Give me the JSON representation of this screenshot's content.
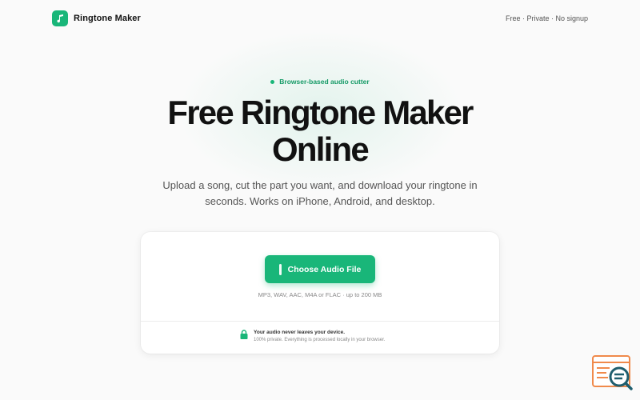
{
  "header": {
    "brand": "Ringtone Maker",
    "logo_icon": "music-note-icon",
    "tagline": "Free · Private · No signup"
  },
  "hero": {
    "pill": "Browser-based audio cutter",
    "title_line1": "Free Ringtone Maker",
    "title_line2": "Online",
    "subtitle_line1": "Upload a song, cut the part you want, and download your ringtone in",
    "subtitle_line2": "seconds. Works on iPhone, Android, and desktop."
  },
  "upload": {
    "button_label": "Choose Audio File",
    "formats": "MP3, WAV, AAC, M4A or FLAC · up to 200 MB"
  },
  "privacy": {
    "icon": "lock-icon",
    "title": "Your audio never leaves your device.",
    "description": "100% private. Everything is processed locally in your browser."
  },
  "colors": {
    "accent": "#19b679",
    "accent_text": "#159a66",
    "widget_orange": "#f08a4b",
    "widget_teal": "#1f5e6e"
  }
}
